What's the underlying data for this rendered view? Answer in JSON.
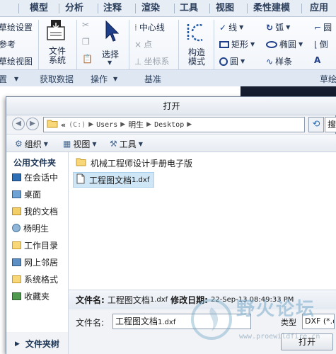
{
  "ribbon": {
    "tabs": [
      "模型",
      "分析",
      "注释",
      "渲染",
      "工具",
      "视图",
      "柔性建模",
      "应用"
    ],
    "left_partial": [
      "草绘设置",
      "参考",
      "草绘视图"
    ],
    "file_system_label": "文件\n系统",
    "select_label": "选择",
    "centerline_label": "中心线",
    "point_label": "点",
    "coord_label": "坐标系",
    "construct_label": "构造\n模式",
    "line_label": "线",
    "rect_label": "矩形",
    "circle_label": "圆",
    "arc_label": "弧",
    "ellipse_label": "椭圆",
    "spline_label": "样条",
    "fillet_label": "圆",
    "chamfer_label": "倒",
    "groups": [
      "置",
      "获取数据",
      "操作",
      "基准",
      "草绘"
    ]
  },
  "dialog": {
    "title": "打开",
    "address": {
      "prefix": "«",
      "drive": "(C:)",
      "segments": [
        "Users",
        "明生",
        "Desktop"
      ]
    },
    "search_placeholder": "搜",
    "toolbar": {
      "organize": "组织",
      "views": "视图",
      "tools": "工具"
    },
    "nav": {
      "header": "公用文件夹",
      "items": [
        "在会话中",
        "桌面",
        "我的文档",
        "杨明生",
        "工作目录",
        "网上邻居",
        "系统格式",
        "收藏夹"
      ],
      "footer": "文件夹树"
    },
    "files": [
      {
        "name": "机械工程师设计手册电子版",
        "ext": ""
      },
      {
        "name": "工程图文档",
        "ext": "1.dxf"
      }
    ],
    "details": {
      "name_label": "文件名:",
      "name_value": "工程图文档",
      "name_ext": "1.dxf",
      "date_label": "修改日期:",
      "date_value": "22-Sep-13 08:49:33 PM"
    },
    "form": {
      "filename_label": "文件名:",
      "filename_value": "工程图文档",
      "filename_ext": "1.dxf",
      "type_label": "类型",
      "type_value": "DXF (*.dx",
      "open_button": "打开"
    }
  },
  "watermark": {
    "text": "野火论坛",
    "url": "www.proewildfire.cn"
  }
}
